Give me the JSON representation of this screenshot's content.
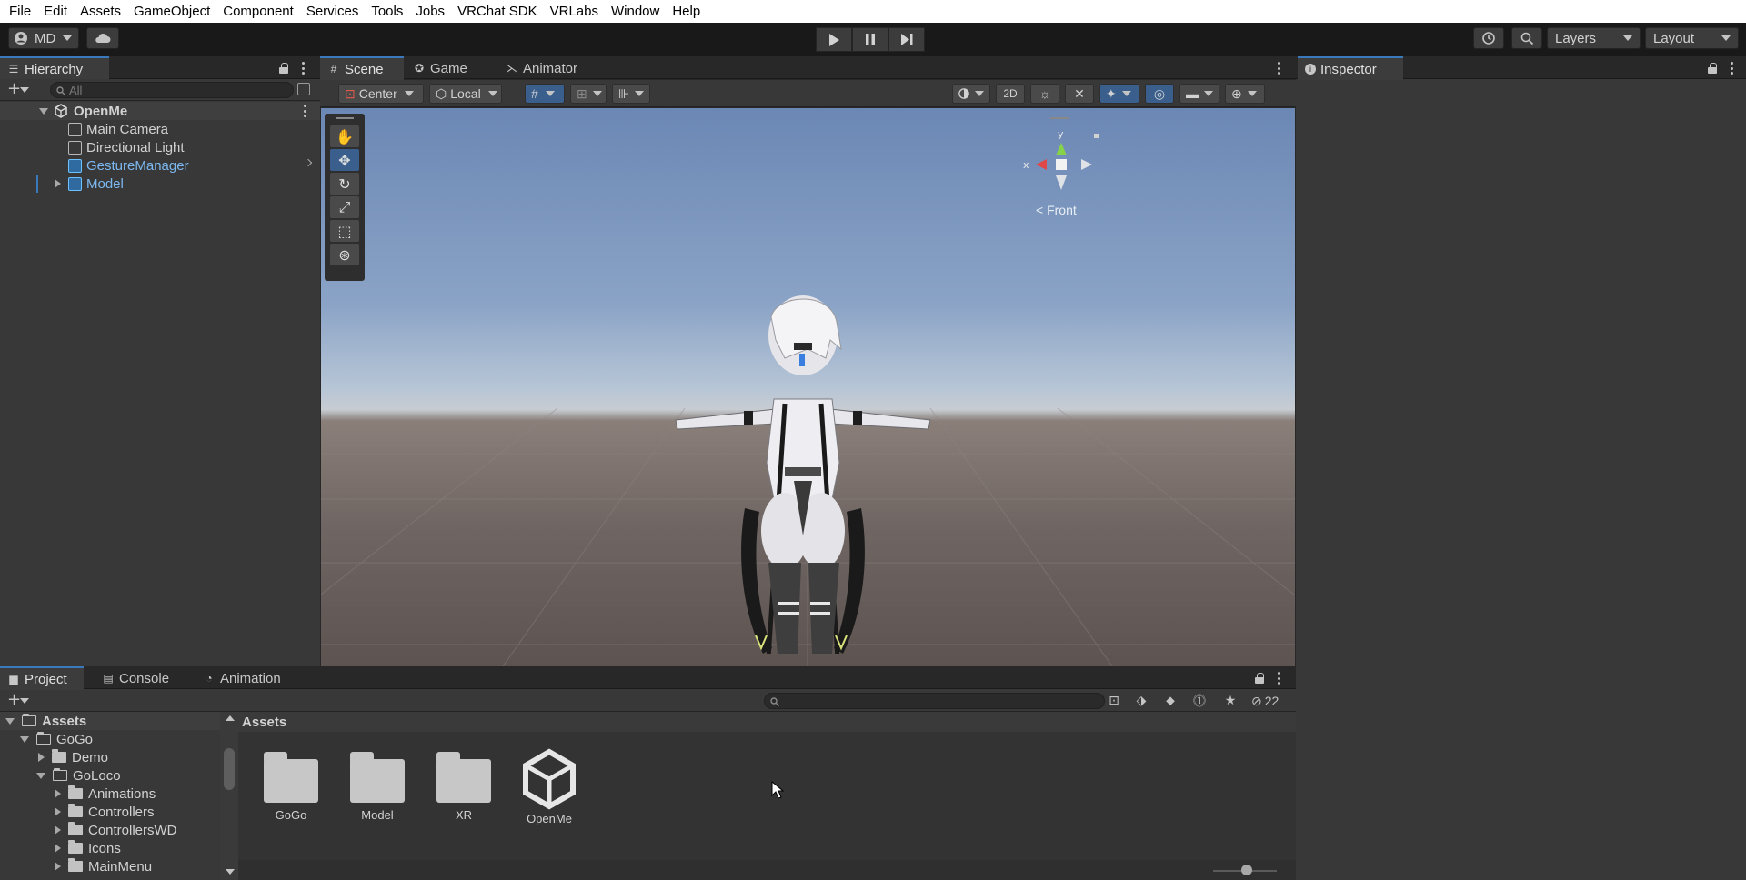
{
  "menu": [
    "File",
    "Edit",
    "Assets",
    "GameObject",
    "Component",
    "Services",
    "Tools",
    "Jobs",
    "VRChat SDK",
    "VRLabs",
    "Window",
    "Help"
  ],
  "toolbar": {
    "account": "MD",
    "layers": "Layers",
    "layout": "Layout"
  },
  "hierarchy": {
    "title": "Hierarchy",
    "search_placeholder": "All",
    "scene": "OpenMe",
    "items": [
      "Main Camera",
      "Directional Light",
      "GestureManager",
      "Model"
    ]
  },
  "scene": {
    "tabs": [
      "Scene",
      "Game",
      "Animator"
    ],
    "pivot": "Center",
    "space": "Local",
    "mode_2d": "2D",
    "gizmo_y": "y",
    "gizmo_x": "x",
    "view": "< Front"
  },
  "inspector": {
    "title": "Inspector"
  },
  "project": {
    "tabs": [
      "Project",
      "Console",
      "Animation"
    ],
    "hidden_count": "22",
    "breadcrumb": "Assets",
    "tree": [
      {
        "label": "Assets",
        "depth": 0,
        "open": true
      },
      {
        "label": "GoGo",
        "depth": 1,
        "open": true
      },
      {
        "label": "Demo",
        "depth": 2,
        "open": false
      },
      {
        "label": "GoLoco",
        "depth": 2,
        "open": true
      },
      {
        "label": "Animations",
        "depth": 3,
        "open": false
      },
      {
        "label": "Controllers",
        "depth": 3,
        "open": false
      },
      {
        "label": "ControllersWD",
        "depth": 3,
        "open": false
      },
      {
        "label": "Icons",
        "depth": 3,
        "open": false
      },
      {
        "label": "MainMenu",
        "depth": 3,
        "open": false
      }
    ],
    "assets": [
      {
        "label": "GoGo",
        "kind": "folder"
      },
      {
        "label": "Model",
        "kind": "folder"
      },
      {
        "label": "XR",
        "kind": "folder"
      },
      {
        "label": "OpenMe",
        "kind": "unity-scene"
      }
    ]
  }
}
